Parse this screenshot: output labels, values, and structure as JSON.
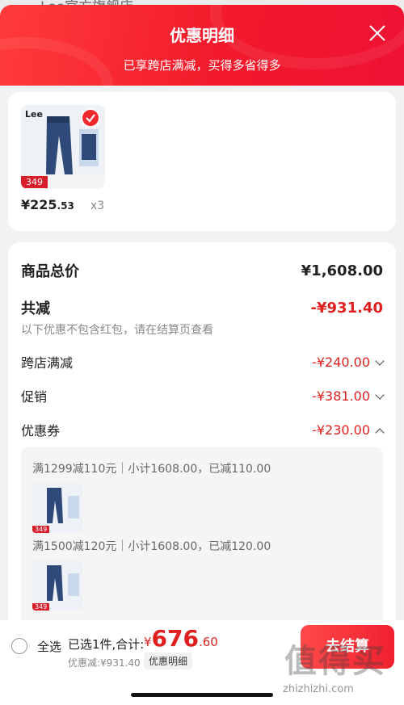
{
  "background_store": "Lee官方旗舰店",
  "header": {
    "title": "优惠明细",
    "subtitle": "已享跨店满减，买得多省得多",
    "close_icon": "close-icon"
  },
  "product": {
    "brand": "Lee",
    "badge_price": "349",
    "price_symbol": "¥",
    "price_int": "225",
    "price_dec": ".53",
    "quantity": "x3",
    "selected": true
  },
  "summary": {
    "total_label": "商品总价",
    "total_value": "¥1,608.00",
    "reduce_label": "共减",
    "reduce_value": "-¥931.40",
    "note": "以下优惠不包含红包，请在结算页查看",
    "items": [
      {
        "label": "跨店满减",
        "value": "-¥240.00",
        "expanded": false
      },
      {
        "label": "促销",
        "value": "-¥381.00",
        "expanded": false
      },
      {
        "label": "优惠券",
        "value": "-¥230.00",
        "expanded": true
      }
    ]
  },
  "coupons": [
    {
      "text": "满1299减110元｜小计1608.00，已减110.00",
      "thumb_price": "349"
    },
    {
      "text": "满1500减120元｜小计1608.00，已减120.00",
      "thumb_price": "349"
    }
  ],
  "bottom": {
    "select_all": "全选",
    "selected_count_text": "已选1件,合计:",
    "total_symbol": "¥",
    "total_int": "676",
    "total_dec": ".60",
    "discount_text": "优惠减:¥931.40",
    "detail_button": "优惠明细",
    "checkout_label": "去结算"
  },
  "watermark": {
    "text": "值得买",
    "url": "zhizhizhi.com"
  },
  "colors": {
    "accent": "#ef2a2f",
    "price": "#e02020"
  }
}
